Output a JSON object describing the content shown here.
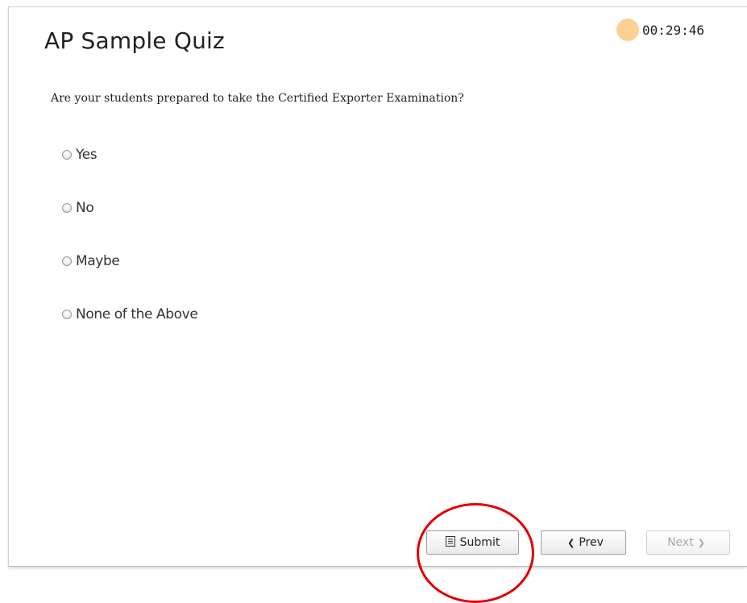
{
  "quiz": {
    "title": "AP Sample Quiz",
    "timer": "00:29:46",
    "timer_color": "#fdd093",
    "question": "Are your students prepared to take the Certified Exporter Examination?",
    "options": [
      {
        "label": "Yes",
        "selected": false
      },
      {
        "label": "No",
        "selected": false
      },
      {
        "label": "Maybe",
        "selected": false
      },
      {
        "label": "None of the Above",
        "selected": false
      }
    ]
  },
  "footer": {
    "submit_label": "Submit",
    "submit_icon": "document-list-icon",
    "prev_label": "Prev",
    "prev_icon": "chevron-left-icon",
    "next_label": "Next",
    "next_icon": "chevron-right-icon",
    "next_disabled": true
  },
  "annotation": {
    "highlight_color": "#e00000",
    "highlight_target": "submit-button"
  }
}
